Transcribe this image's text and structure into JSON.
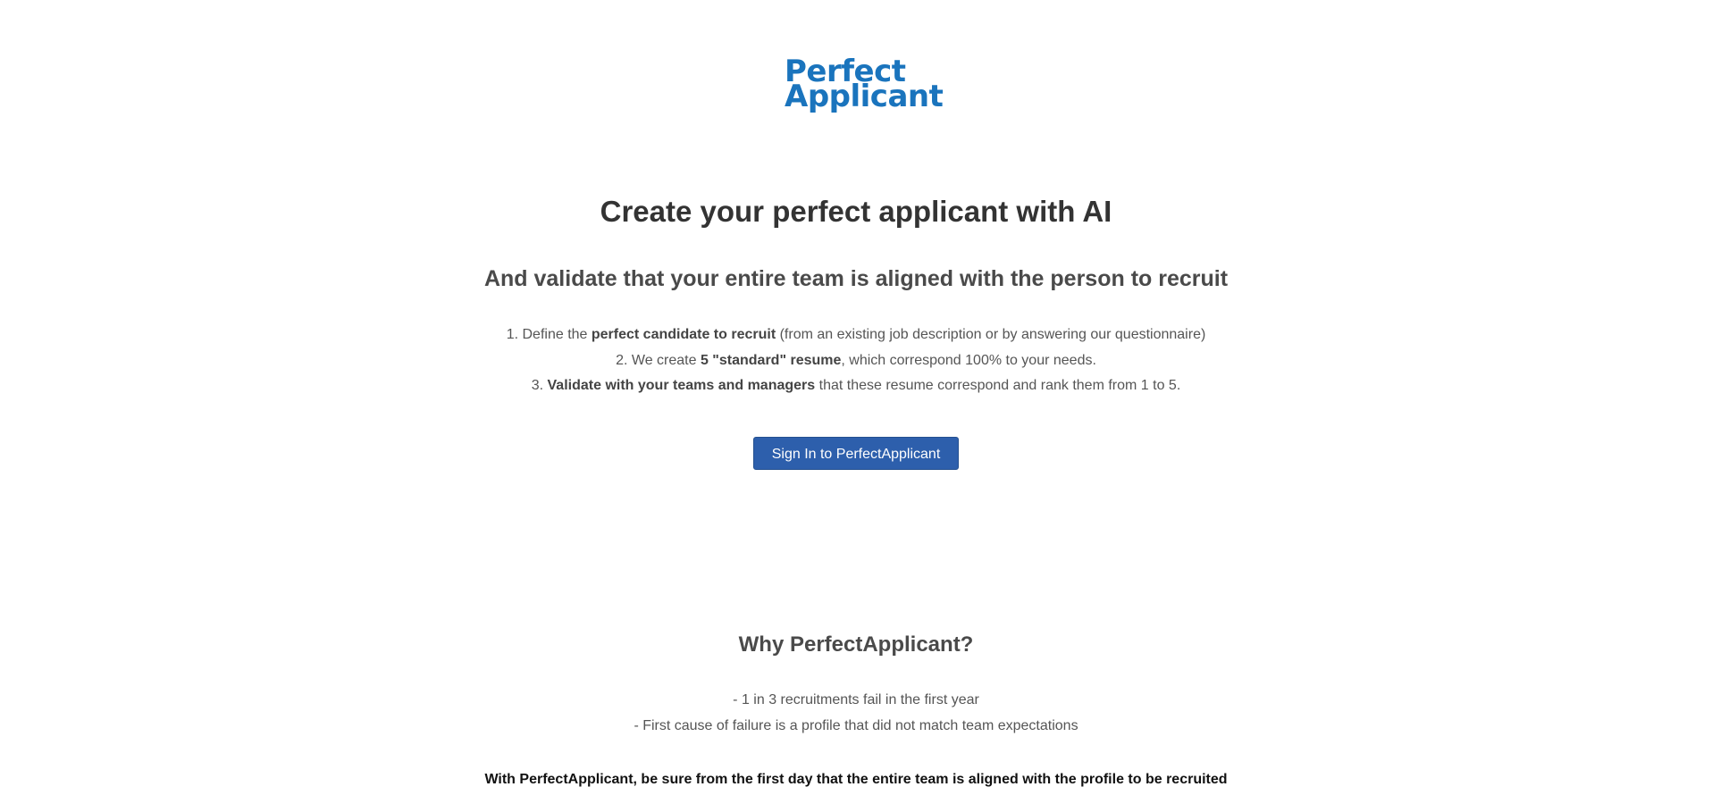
{
  "header": {
    "logo_line1": "Perfect",
    "logo_line2": "Applicant",
    "logo_color": "#1a74bd"
  },
  "hero": {
    "title": "Create your perfect applicant with AI",
    "subtitle": "And validate that your entire team is aligned with the person to recruit"
  },
  "steps": [
    {
      "prefix": "1. Define the ",
      "bold": "perfect candidate to recruit",
      "suffix": " (from an existing job description or by answering our questionnaire)"
    },
    {
      "prefix": "2. We create ",
      "bold": "5 \"standard\" resume",
      "suffix": ", which correspond 100% to your needs."
    },
    {
      "prefix": "3. ",
      "bold": "Validate with your teams and managers",
      "suffix": " that these resume correspond and rank them from 1 to 5."
    }
  ],
  "cta": {
    "label": "Sign In to PerfectApplicant",
    "color": "#2d5fac"
  },
  "why": {
    "title": "Why PerfectApplicant?",
    "points": [
      "- 1 in 3 recruitments fail in the first year",
      "- First cause of failure is a profile that did not match team expectations"
    ],
    "closing": "With PerfectApplicant, be sure from the first day that the entire team is aligned with the profile to be recruited"
  }
}
